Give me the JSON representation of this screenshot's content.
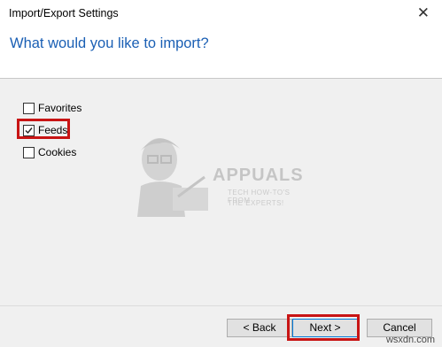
{
  "window": {
    "title": "Import/Export Settings",
    "close_glyph": "✕"
  },
  "header": {
    "heading": "What would you like to import?"
  },
  "options": [
    {
      "label": "Favorites",
      "checked": false
    },
    {
      "label": "Feeds",
      "checked": true
    },
    {
      "label": "Cookies",
      "checked": false
    }
  ],
  "logo": {
    "word": "APPUALS",
    "tagline_1": "TECH HOW-TO'S FROM",
    "tagline_2": "THE EXPERTS!"
  },
  "buttons": {
    "back": "< Back",
    "next": "Next >",
    "cancel": "Cancel"
  },
  "watermark": "wsxdn.com",
  "colors": {
    "heading": "#1a5fb4",
    "highlight": "#c81414",
    "default_button_border": "#0078d7"
  }
}
